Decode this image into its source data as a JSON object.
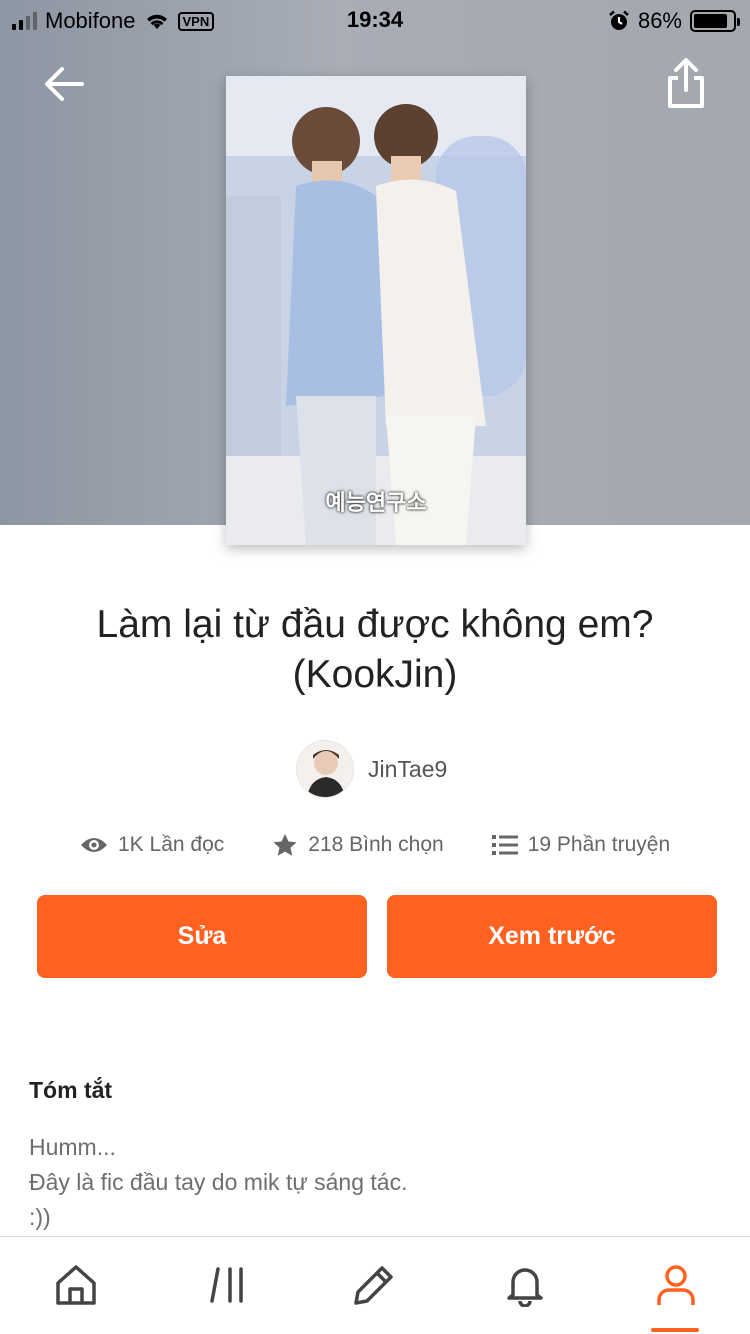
{
  "status_bar": {
    "carrier": "Mobifone",
    "vpn": "VPN",
    "time": "19:34",
    "battery_percent": "86%",
    "battery_level": 0.86
  },
  "header": {
    "back_icon": "arrow-left-icon",
    "share_icon": "share-icon"
  },
  "cover": {
    "caption": "예능연구소"
  },
  "story": {
    "title_line1": "Làm lại từ đầu được không em?",
    "title_line2": "(KookJin)",
    "author": "JinTae9"
  },
  "stats": {
    "reads": "1K Lần đọc",
    "votes": "218 Bình chọn",
    "parts": "19 Phần truyện"
  },
  "actions": {
    "edit_label": "Sửa",
    "preview_label": "Xem trước"
  },
  "summary": {
    "heading": "Tóm tắt",
    "lines": [
      "Humm...",
      "Đây là fic đầu tay do mik tự sáng tác.",
      ":))"
    ]
  },
  "tab_bar": {
    "items": [
      "home-icon",
      "library-icon",
      "write-icon",
      "notifications-icon",
      "profile-icon"
    ],
    "active": "profile-icon"
  },
  "colors": {
    "accent": "#ff6120",
    "hero_background": "#9aa0aa"
  }
}
